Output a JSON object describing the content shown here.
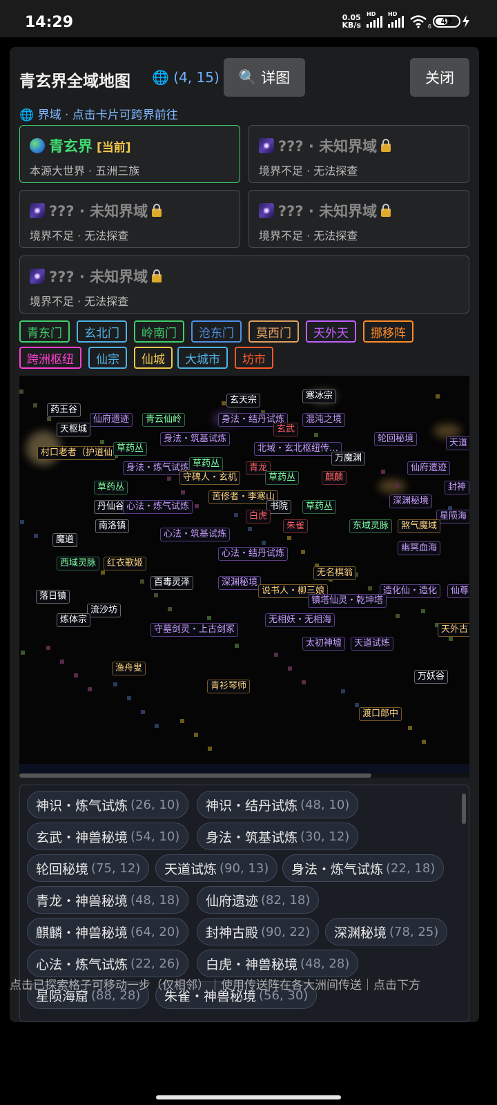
{
  "status": {
    "time": "14:29",
    "net_speed_value": "0.05",
    "net_speed_unit": "KB/s",
    "battery": "47",
    "wifi_label": "6",
    "hd": "HD"
  },
  "header": {
    "title": "青玄界全域地图",
    "coords": "(4, 15)",
    "detail_button": "详图",
    "close_button": "关闭"
  },
  "realm_hint": "界域 · 点击卡片可跨界前往",
  "realms": [
    {
      "name": "青玄界",
      "tag": "[当前]",
      "sub": "本源大世界 · 五洲三族"
    },
    {
      "name": "??? · 未知界域",
      "tag": "",
      "sub": "境界不足 · 无法探查"
    },
    {
      "name": "??? · 未知界域",
      "tag": "",
      "sub": "境界不足 · 无法探查"
    },
    {
      "name": "??? · 未知界域",
      "tag": "",
      "sub": "境界不足 · 无法探查"
    },
    {
      "name": "??? · 未知界域",
      "tag": "",
      "sub": "境界不足 · 无法探查"
    }
  ],
  "filters": [
    {
      "label": "青东门",
      "color": "#3fcf6a"
    },
    {
      "label": "玄北门",
      "color": "#4fb3e6"
    },
    {
      "label": "岭南门",
      "color": "#3fcf6a"
    },
    {
      "label": "沧东门",
      "color": "#4f8fe6"
    },
    {
      "label": "莫西门",
      "color": "#e0a060"
    },
    {
      "label": "天外天",
      "color": "#c060ff"
    },
    {
      "label": "挪移阵",
      "color": "#ff8c2a"
    },
    {
      "label": "跨洲枢纽",
      "color": "#ff3fd0"
    },
    {
      "label": "仙宗",
      "color": "#4fb3e6"
    },
    {
      "label": "仙城",
      "color": "#f2c94c"
    },
    {
      "label": "大城市",
      "color": "#4fb3e6"
    },
    {
      "label": "坊市",
      "color": "#ff5a2a"
    }
  ],
  "map_locations": [
    {
      "label": "药王谷",
      "type": "town"
    },
    {
      "label": "天枢城",
      "type": "town"
    },
    {
      "label": "村口老者（护道仙",
      "type": "npc"
    },
    {
      "label": "仙府遗迹",
      "type": "trial"
    },
    {
      "label": "青云仙岭",
      "type": "herb"
    },
    {
      "label": "玄天宗",
      "type": "town"
    },
    {
      "label": "寒冰宗",
      "type": "town"
    },
    {
      "label": "身法・结丹试炼",
      "type": "trial"
    },
    {
      "label": "混沌之境",
      "type": "trial"
    },
    {
      "label": "玄武",
      "type": "beast"
    },
    {
      "label": "身法・筑基试炼",
      "type": "trial"
    },
    {
      "label": "草药丛",
      "type": "herb"
    },
    {
      "label": "北域・玄北枢纽传…",
      "type": "trial"
    },
    {
      "label": "轮回秘境",
      "type": "trial"
    },
    {
      "label": "天道",
      "type": "trial"
    },
    {
      "label": "万魔渊",
      "type": "town"
    },
    {
      "label": "身法・炼气试炼",
      "type": "trial"
    },
    {
      "label": "草药丛",
      "type": "herb"
    },
    {
      "label": "青龙",
      "type": "beast"
    },
    {
      "label": "仙府遗迹",
      "type": "trial"
    },
    {
      "label": "守碑人・玄机",
      "type": "npc"
    },
    {
      "label": "草药丛",
      "type": "herb"
    },
    {
      "label": "麒麟",
      "type": "beast"
    },
    {
      "label": "封神",
      "type": "trial"
    },
    {
      "label": "草药丛",
      "type": "herb"
    },
    {
      "label": "苦修者・李寒山",
      "type": "npc"
    },
    {
      "label": "深渊秘境",
      "type": "trial"
    },
    {
      "label": "丹仙谷",
      "type": "town"
    },
    {
      "label": "心法・炼气试炼",
      "type": "trial"
    },
    {
      "label": "书院",
      "type": "town"
    },
    {
      "label": "草药丛",
      "type": "herb"
    },
    {
      "label": "星陨海",
      "type": "trial"
    },
    {
      "label": "白虎",
      "type": "beast"
    },
    {
      "label": "南洛镇",
      "type": "town"
    },
    {
      "label": "朱雀",
      "type": "beast"
    },
    {
      "label": "东域灵脉",
      "type": "herb"
    },
    {
      "label": "煞气魔域",
      "type": "npc"
    },
    {
      "label": "心法・筑基试炼",
      "type": "trial"
    },
    {
      "label": "魔道",
      "type": "town"
    },
    {
      "label": "幽冥血海",
      "type": "trial"
    },
    {
      "label": "心法・结丹试炼",
      "type": "trial"
    },
    {
      "label": "西域灵脉",
      "type": "herb"
    },
    {
      "label": "红衣歌姬",
      "type": "npc"
    },
    {
      "label": "无名棋翁",
      "type": "npc"
    },
    {
      "label": "百毒灵泽",
      "type": "town"
    },
    {
      "label": "深渊秘境",
      "type": "trial"
    },
    {
      "label": "说书人・柳三娘",
      "type": "npc"
    },
    {
      "label": "造化仙・造化",
      "type": "trial"
    },
    {
      "label": "仙尊",
      "type": "trial"
    },
    {
      "label": "镇塔仙灵・乾坤塔",
      "type": "trial"
    },
    {
      "label": "落日镇",
      "type": "town"
    },
    {
      "label": "流沙坊",
      "type": "town"
    },
    {
      "label": "炼体宗",
      "type": "town"
    },
    {
      "label": "无相妖・无相海",
      "type": "trial"
    },
    {
      "label": "守墓剑灵・上古剑冢",
      "type": "trial"
    },
    {
      "label": "天外古",
      "type": "npc"
    },
    {
      "label": "太初神墟",
      "type": "trial"
    },
    {
      "label": "天道试炼",
      "type": "trial"
    },
    {
      "label": "渔舟叟",
      "type": "npc"
    },
    {
      "label": "万妖谷",
      "type": "town"
    },
    {
      "label": "青衫琴师",
      "type": "npc"
    },
    {
      "label": "渡口郎中",
      "type": "npc"
    }
  ],
  "trials": [
    {
      "name": "神识・炼气试炼",
      "coord": "(26, 10)"
    },
    {
      "name": "神识・结丹试炼",
      "coord": "(48, 10)"
    },
    {
      "name": "玄武・神兽秘境",
      "coord": "(54, 10)"
    },
    {
      "name": "身法・筑基试炼",
      "coord": "(30, 12)"
    },
    {
      "name": "轮回秘境",
      "coord": "(75, 12)"
    },
    {
      "name": "天道试炼",
      "coord": "(90, 13)"
    },
    {
      "name": "身法・炼气试炼",
      "coord": "(22, 18)"
    },
    {
      "name": "青龙・神兽秘境",
      "coord": "(48, 18)"
    },
    {
      "name": "仙府遗迹",
      "coord": "(82, 18)"
    },
    {
      "name": "麒麟・神兽秘境",
      "coord": "(64, 20)"
    },
    {
      "name": "封神古殿",
      "coord": "(90, 22)"
    },
    {
      "name": "深渊秘境",
      "coord": "(78, 25)"
    },
    {
      "name": "心法・炼气试炼",
      "coord": "(22, 26)"
    },
    {
      "name": "白虎・神兽秘境",
      "coord": "(48, 28)"
    },
    {
      "name": "星陨海窟",
      "coord": "(88, 28)"
    },
    {
      "name": "朱雀・神兽秘境",
      "coord": "(56, 30)"
    }
  ],
  "footer": "点击已探索格子可移动一步（仅相邻）｜使用传送阵在各大洲间传送｜点击下方"
}
